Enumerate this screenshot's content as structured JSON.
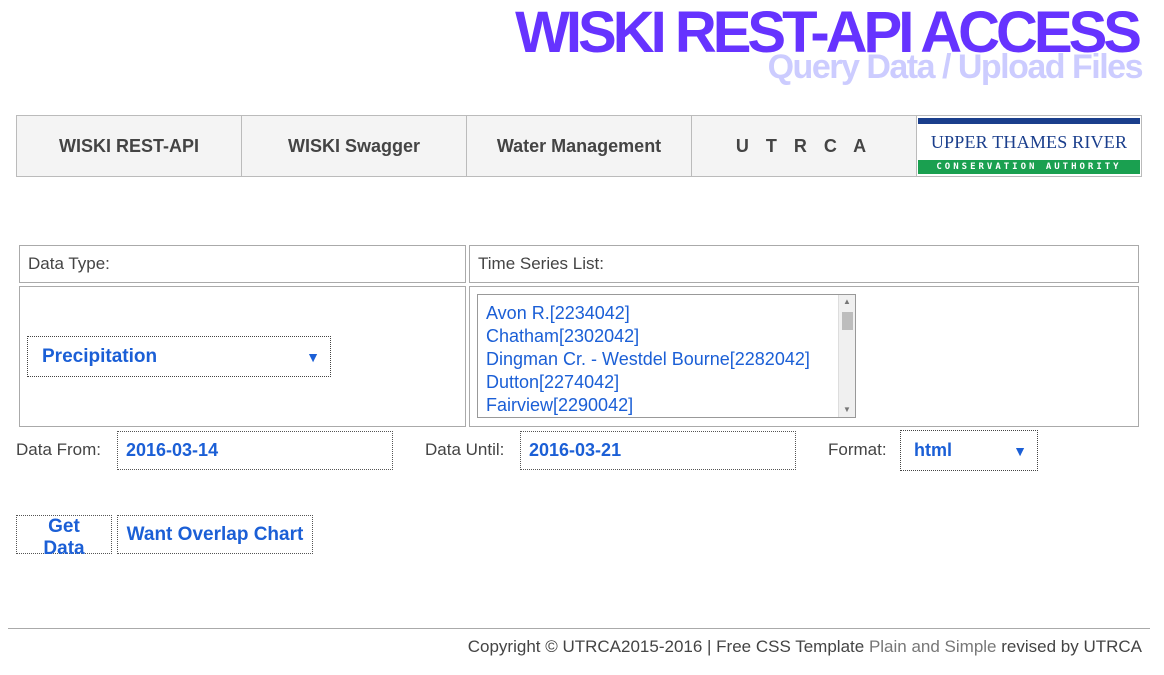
{
  "header": {
    "title": "WISKI REST-API ACCESS",
    "subtitle": "Query Data / Upload Files"
  },
  "nav": {
    "items": [
      {
        "label": "WISKI REST-API"
      },
      {
        "label": "WISKI Swagger"
      },
      {
        "label": "Water Management"
      },
      {
        "label": "U T R C A"
      }
    ],
    "logo": {
      "name": "UPPER THAMES RIVER",
      "tagline": "CONSERVATION AUTHORITY",
      "colors": {
        "blue": "#1a3e8c",
        "green": "#1aa050"
      }
    }
  },
  "form": {
    "data_type_label": "Data Type:",
    "time_series_label": "Time Series List:",
    "data_type_value": "Precipitation",
    "time_series_options": [
      "Avon R.[2234042]",
      "Chatham[2302042]",
      "Dingman Cr. - Westdel Bourne[2282042]",
      "Dutton[2274042]",
      "Fairview[2290042]"
    ],
    "data_from_label": "Data From:",
    "data_from_value": "2016-03-14",
    "data_until_label": "Data Until:",
    "data_until_value": "2016-03-21",
    "format_label": "Format:",
    "format_value": "html",
    "get_data_label": "Get Data",
    "overlap_chart_label": "Want Overlap Chart"
  },
  "footer": {
    "copyright": "Copyright © UTRCA2015-2016 | Free CSS Template ",
    "template_name": "Plain and Simple",
    "revised": " revised by UTRCA"
  },
  "colors": {
    "title": "#6633ff",
    "subtitle": "#ccccff",
    "link": "#1b5fd6"
  }
}
